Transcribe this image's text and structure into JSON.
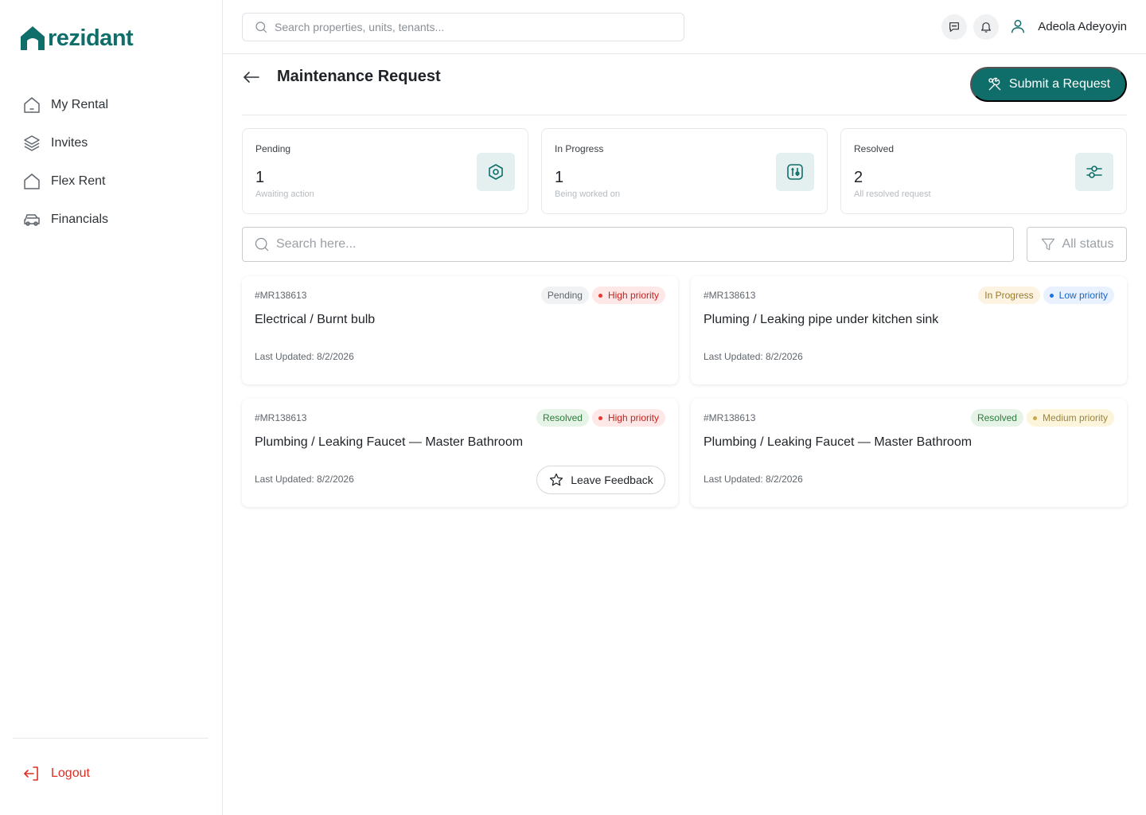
{
  "colors": {
    "brand": "#0f6e6a",
    "danger": "#d93025"
  },
  "brand": {
    "name": "rezidant"
  },
  "sidebar": {
    "items": [
      {
        "label": "My Rental",
        "icon": "home-icon"
      },
      {
        "label": "Invites",
        "icon": "layers-icon"
      },
      {
        "label": "Flex Rent",
        "icon": "home-icon"
      },
      {
        "label": "Financials",
        "icon": "car-icon"
      }
    ],
    "logout_label": "Logout"
  },
  "topbar": {
    "search_placeholder": "Search properties, units, tenants...",
    "user_name": "Adeola Adeyoyin"
  },
  "page": {
    "title": "Maintenance Request",
    "submit_label": "Submit a Request"
  },
  "stats": [
    {
      "label": "Pending",
      "value": "1",
      "sub": "Awaiting action",
      "icon": "hexagon-nut-icon"
    },
    {
      "label": "In Progress",
      "value": "1",
      "sub": "Being worked on",
      "icon": "tools-icon"
    },
    {
      "label": "Resolved",
      "value": "2",
      "sub": "All resolved request",
      "icon": "sliders-icon"
    }
  ],
  "filters": {
    "search_placeholder": "Search here...",
    "status_label": "All status"
  },
  "requests": [
    {
      "id": "#MR138613",
      "title": "Electrical / Burnt bulb",
      "status": "Pending",
      "priority": "High priority",
      "date": "Last Updated: 8/2/2026"
    },
    {
      "id": "#MR138613",
      "title": "Pluming / Leaking pipe under kitchen sink",
      "status": "In Progress",
      "priority": "Low priority",
      "date": "Last Updated: 8/2/2026"
    },
    {
      "id": "#MR138613",
      "title": "Plumbing / Leaking Faucet — Master Bathroom",
      "status": "Resolved",
      "priority": "High priority",
      "date": "Last Updated: 8/2/2026",
      "action_label": "Leave Feedback"
    },
    {
      "id": "#MR138613",
      "title": "Plumbing / Leaking Faucet — Master Bathroom",
      "status": "Resolved",
      "priority": "Medium priority",
      "date": "Last Updated: 8/2/2026"
    }
  ]
}
